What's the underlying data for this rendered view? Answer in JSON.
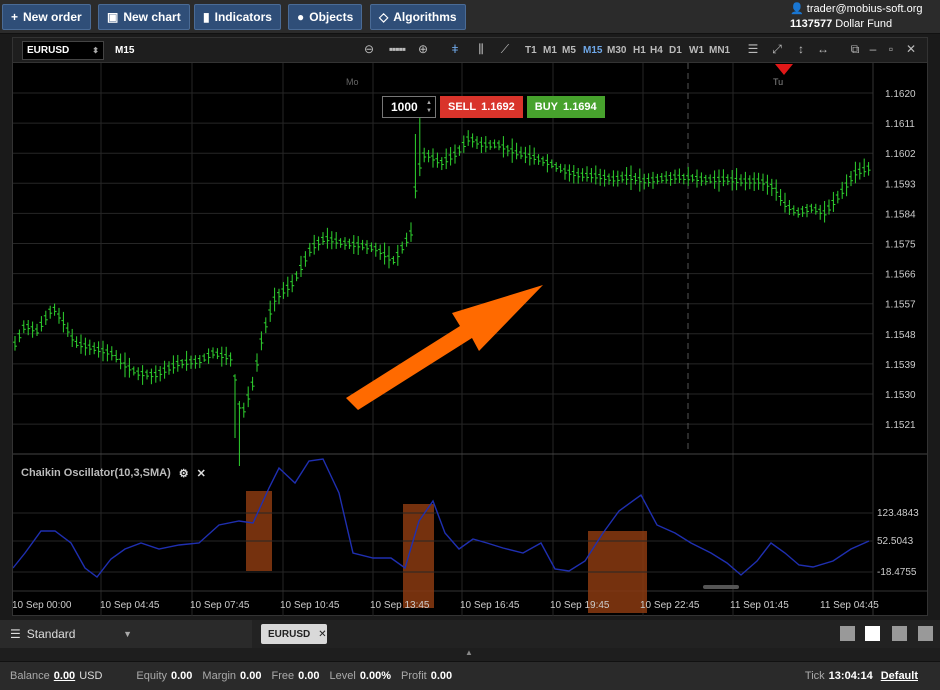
{
  "toolbar": {
    "new_order": "New order",
    "new_chart": "New chart",
    "indicators": "Indicators",
    "objects": "Objects",
    "algorithms": "Algorithms"
  },
  "account": {
    "user": "trader@mobius-soft.org",
    "number": "1137577",
    "name": "Dollar Fund"
  },
  "chart": {
    "symbol": "EURUSD",
    "timeframe": "M15",
    "timeframes": [
      "T1",
      "M1",
      "M5",
      "M15",
      "M30",
      "H1",
      "H4",
      "D1",
      "W1",
      "MN1"
    ],
    "active_timeframe": "M15",
    "day_labels": [
      "Mo",
      "Tu"
    ],
    "price_ticks": [
      "1.1620",
      "1.1611",
      "1.1602",
      "1.1593",
      "1.1584",
      "1.1575",
      "1.1566",
      "1.1557",
      "1.1548",
      "1.1539",
      "1.1530",
      "1.1521"
    ],
    "time_ticks": [
      "10 Sep 00:00",
      "10 Sep 04:45",
      "10 Sep 07:45",
      "10 Sep 10:45",
      "10 Sep 13:45",
      "10 Sep 16:45",
      "10 Sep 19:45",
      "10 Sep 22:45",
      "11 Sep 01:45",
      "11 Sep 04:45"
    ],
    "candle_color": "#2fd32f"
  },
  "trade": {
    "quantity": "1000",
    "sell_label": "SELL",
    "sell_price": "1.1692",
    "buy_label": "BUY",
    "buy_price": "1.1694"
  },
  "oscillator": {
    "title": "Chaikin Oscillator(10,3,SMA)",
    "ticks": [
      "123.4843",
      "52.5043",
      "-18.4755"
    ],
    "line_color": "#1f2fb0"
  },
  "bottom": {
    "profile": "Standard",
    "tab": "EURUSD"
  },
  "status": {
    "balance_label": "Balance",
    "balance": "0.00",
    "balance_ccy": "USD",
    "equity_label": "Equity",
    "equity": "0.00",
    "margin_label": "Margin",
    "margin": "0.00",
    "free_label": "Free",
    "free": "0.00",
    "level_label": "Level",
    "level": "0.00%",
    "profit_label": "Profit",
    "profit": "0.00",
    "tick_label": "Tick",
    "tick": "13:04:14",
    "default_label": "Default"
  },
  "colors": {
    "arrow": "#ff6a00",
    "highlight": "#8a3a10",
    "sell": "#d9342b",
    "buy": "#47a22d",
    "toolbar_button": "#2f4e78"
  }
}
